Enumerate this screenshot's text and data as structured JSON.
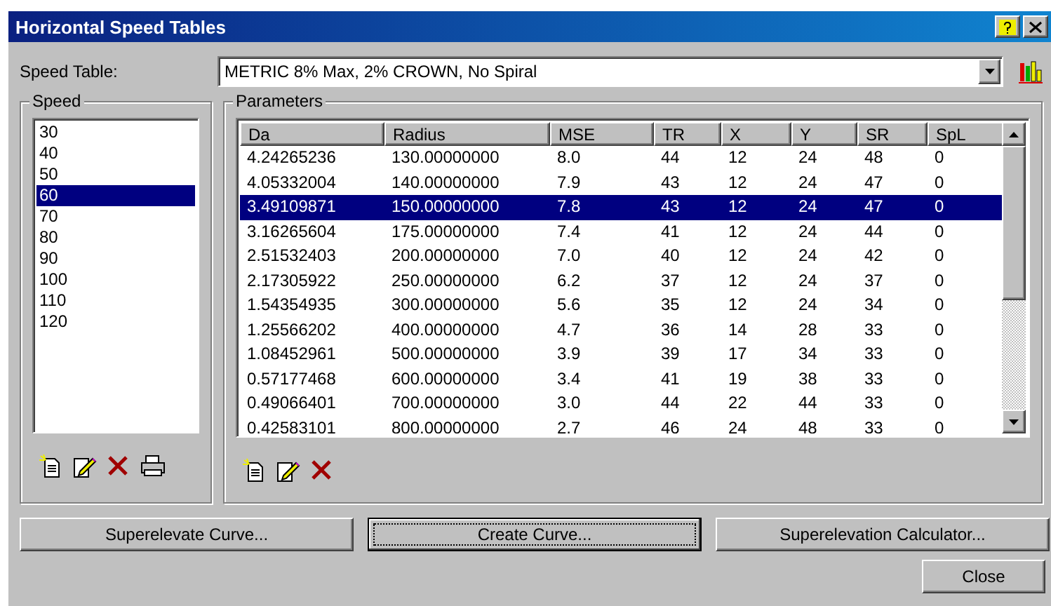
{
  "window": {
    "title": "Horizontal Speed Tables"
  },
  "speed_table": {
    "label": "Speed Table:",
    "value": "METRIC 8% Max, 2% CROWN, No Spiral"
  },
  "speed_group": {
    "title": "Speed",
    "items": [
      {
        "label": "30",
        "selected": false
      },
      {
        "label": "40",
        "selected": false
      },
      {
        "label": "50",
        "selected": false
      },
      {
        "label": "60",
        "selected": true
      },
      {
        "label": "70",
        "selected": false
      },
      {
        "label": "80",
        "selected": false
      },
      {
        "label": "90",
        "selected": false
      },
      {
        "label": "100",
        "selected": false
      },
      {
        "label": "110",
        "selected": false
      },
      {
        "label": "120",
        "selected": false
      }
    ]
  },
  "parameters": {
    "title": "Parameters",
    "columns": [
      "Da",
      "Radius",
      "MSE",
      "TR",
      "X",
      "Y",
      "SR",
      "SpL"
    ],
    "rows": [
      {
        "cells": [
          "4.24265236",
          "130.00000000",
          "8.0",
          "44",
          "12",
          "24",
          "48",
          "0"
        ],
        "selected": false
      },
      {
        "cells": [
          "4.05332004",
          "140.00000000",
          "7.9",
          "43",
          "12",
          "24",
          "47",
          "0"
        ],
        "selected": false
      },
      {
        "cells": [
          "3.49109871",
          "150.00000000",
          "7.8",
          "43",
          "12",
          "24",
          "47",
          "0"
        ],
        "selected": true
      },
      {
        "cells": [
          "3.16265604",
          "175.00000000",
          "7.4",
          "41",
          "12",
          "24",
          "44",
          "0"
        ],
        "selected": false
      },
      {
        "cells": [
          "2.51532403",
          "200.00000000",
          "7.0",
          "40",
          "12",
          "24",
          "42",
          "0"
        ],
        "selected": false
      },
      {
        "cells": [
          "2.17305922",
          "250.00000000",
          "6.2",
          "37",
          "12",
          "24",
          "37",
          "0"
        ],
        "selected": false
      },
      {
        "cells": [
          "1.54354935",
          "300.00000000",
          "5.6",
          "35",
          "12",
          "24",
          "34",
          "0"
        ],
        "selected": false
      },
      {
        "cells": [
          "1.25566202",
          "400.00000000",
          "4.7",
          "36",
          "14",
          "28",
          "33",
          "0"
        ],
        "selected": false
      },
      {
        "cells": [
          "1.08452961",
          "500.00000000",
          "3.9",
          "39",
          "17",
          "34",
          "33",
          "0"
        ],
        "selected": false
      },
      {
        "cells": [
          "0.57177468",
          "600.00000000",
          "3.4",
          "41",
          "19",
          "38",
          "33",
          "0"
        ],
        "selected": false
      },
      {
        "cells": [
          "0.49066401",
          "700.00000000",
          "3.0",
          "44",
          "22",
          "44",
          "33",
          "0"
        ],
        "selected": false
      },
      {
        "cells": [
          "0.42583101",
          "800.00000000",
          "2.7",
          "46",
          "24",
          "48",
          "33",
          "0"
        ],
        "selected": false
      }
    ]
  },
  "buttons": [
    {
      "label": "Superelevate Curve...",
      "focused": false
    },
    {
      "label": "Create Curve...",
      "focused": true
    },
    {
      "label": "Superelevation Calculator..."
    }
  ],
  "close_button": {
    "label": "Close"
  }
}
